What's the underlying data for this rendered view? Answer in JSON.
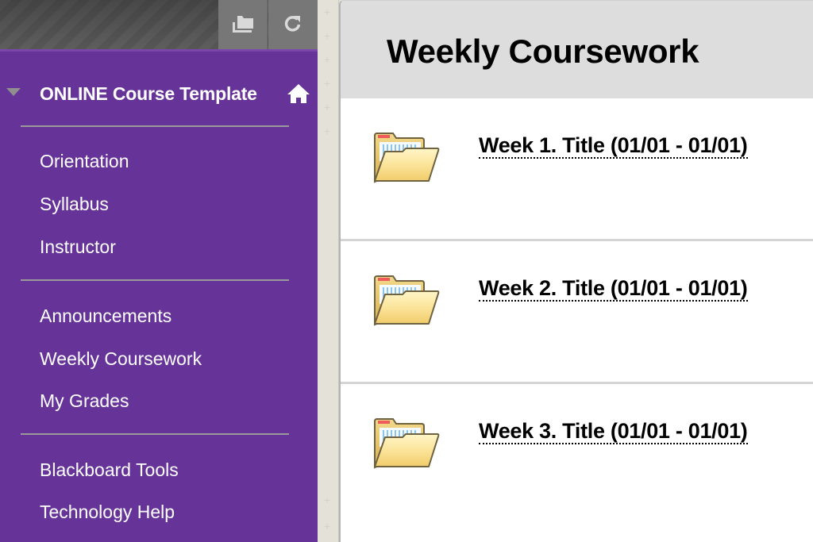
{
  "sidebar": {
    "toolbar": {
      "folder_view_icon": "folder-view-icon",
      "refresh_icon": "refresh-icon"
    },
    "course": {
      "title": "ONLINE Course Template",
      "collapse_icon": "triangle-down-icon",
      "home_icon": "home-icon"
    },
    "groups": [
      {
        "items": [
          {
            "label": "Orientation"
          },
          {
            "label": "Syllabus"
          },
          {
            "label": "Instructor"
          }
        ]
      },
      {
        "items": [
          {
            "label": "Announcements"
          },
          {
            "label": "Weekly Coursework"
          },
          {
            "label": "My Grades"
          }
        ]
      },
      {
        "items": [
          {
            "label": "Blackboard Tools"
          },
          {
            "label": "Technology Help"
          }
        ]
      }
    ],
    "colors": {
      "background": "#663399",
      "text": "#ffffff",
      "divider": "#9a9a9a"
    }
  },
  "main": {
    "title": "Weekly Coursework",
    "weeks": [
      {
        "title": "Week 1. Title (01/01 - 01/01)",
        "icon": "folder-icon"
      },
      {
        "title": "Week 2. Title (01/01 - 01/01)",
        "icon": "folder-icon"
      },
      {
        "title": "Week 3. Title (01/01 - 01/01)",
        "icon": "folder-icon"
      }
    ]
  }
}
